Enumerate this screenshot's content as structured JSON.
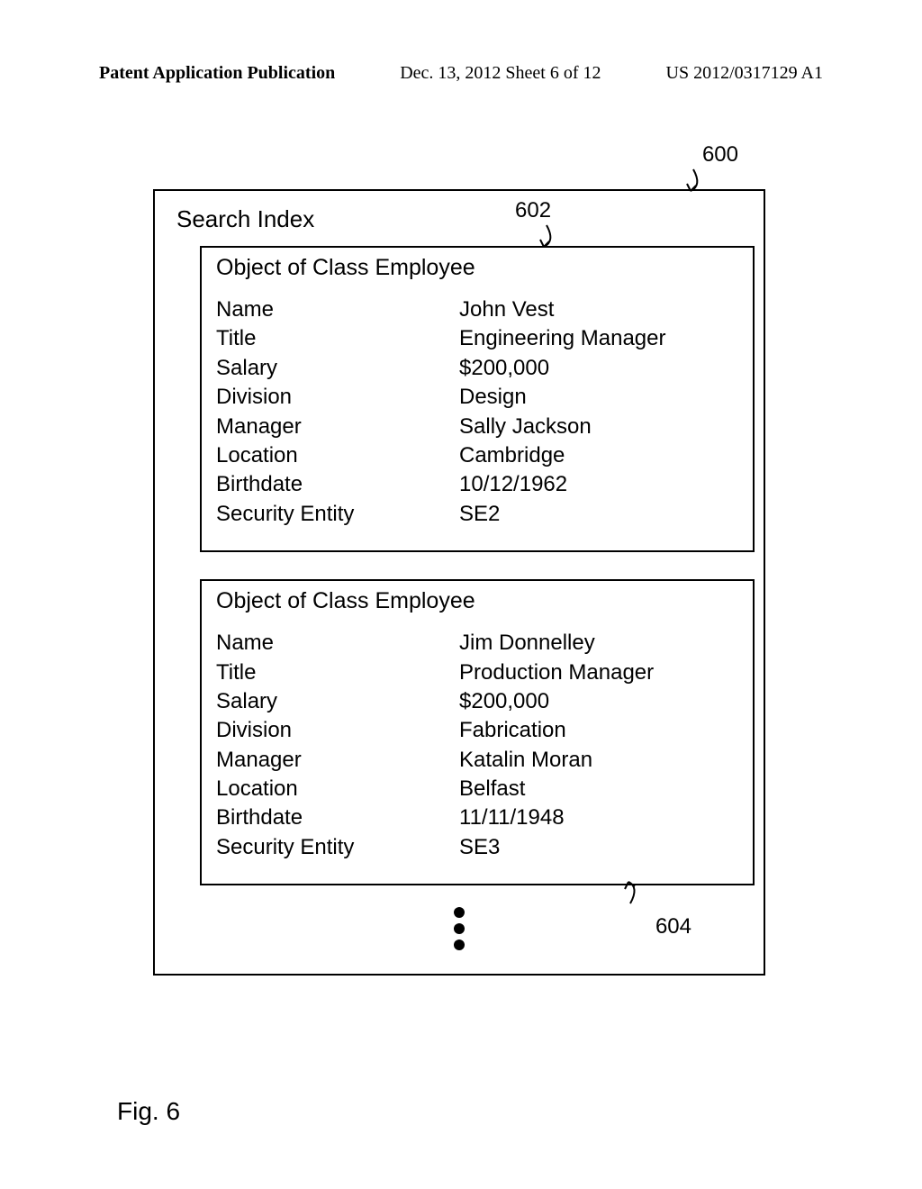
{
  "header": {
    "left": "Patent Application Publication",
    "center": "Dec. 13, 2012  Sheet 6 of 12",
    "right": "US 2012/0317129 A1"
  },
  "refs": {
    "r600": "600",
    "r602": "602",
    "r604": "604"
  },
  "outer_title": "Search Index",
  "employees": [
    {
      "class_title": "Object of Class Employee",
      "fields": [
        {
          "key": "Name",
          "val": "John Vest"
        },
        {
          "key": "Title",
          "val": "Engineering Manager"
        },
        {
          "key": "Salary",
          "val": "$200,000"
        },
        {
          "key": "Division",
          "val": "Design"
        },
        {
          "key": "Manager",
          "val": "Sally Jackson"
        },
        {
          "key": "Location",
          "val": "Cambridge"
        },
        {
          "key": "Birthdate",
          "val": "10/12/1962"
        },
        {
          "key": "Security Entity",
          "val": "SE2"
        }
      ]
    },
    {
      "class_title": "Object of Class Employee",
      "fields": [
        {
          "key": "Name",
          "val": "Jim Donnelley"
        },
        {
          "key": "Title",
          "val": "Production Manager"
        },
        {
          "key": "Salary",
          "val": "$200,000"
        },
        {
          "key": "Division",
          "val": "Fabrication"
        },
        {
          "key": "Manager",
          "val": "Katalin Moran"
        },
        {
          "key": "Location",
          "val": "Belfast"
        },
        {
          "key": "Birthdate",
          "val": "11/11/1948"
        },
        {
          "key": "Security Entity",
          "val": "SE3"
        }
      ]
    }
  ],
  "figure_label": "Fig. 6"
}
